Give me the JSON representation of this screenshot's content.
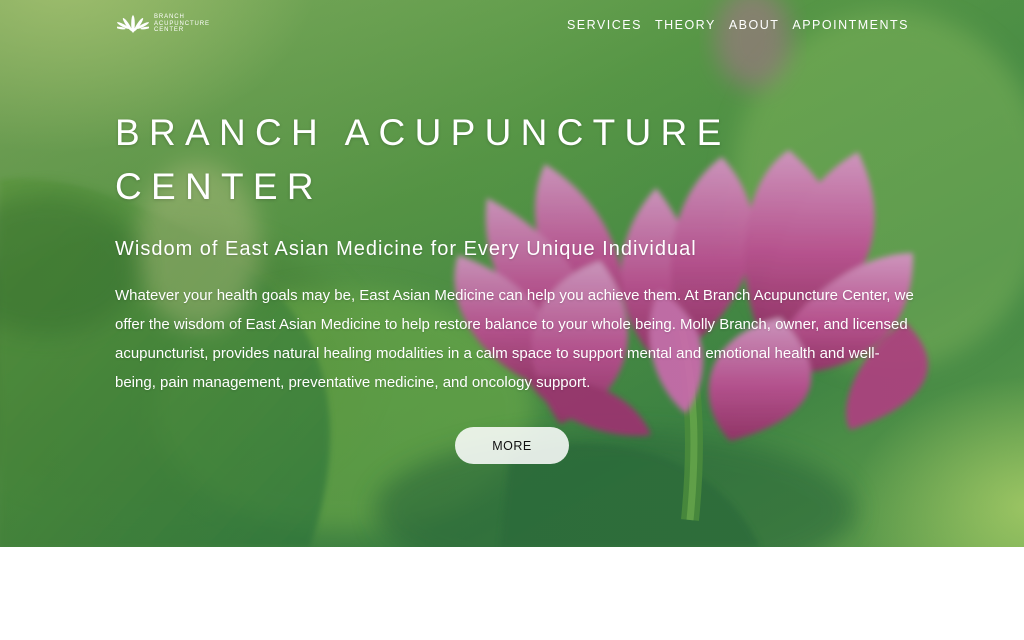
{
  "brand": {
    "logo_lines": [
      "BRANCH",
      "ACUPUNCTURE",
      "CENTER"
    ]
  },
  "nav": {
    "items": [
      {
        "label": "SERVICES"
      },
      {
        "label": "THEORY"
      },
      {
        "label": "ABOUT"
      },
      {
        "label": "APPOINTMENTS"
      }
    ]
  },
  "hero": {
    "title": "BRANCH ACUPUNCTURE CENTER",
    "subtitle": "Wisdom of East Asian Medicine for Every Unique Individual",
    "body": "Whatever your health goals may be, East Asian Medicine can help you achieve them. At Branch Acupuncture Center, we offer the wisdom of East Asian Medicine to help restore balance to your whole being. Molly Branch, owner, and licensed acupuncturist, provides natural healing modalities in a calm space to support mental and emotional health and well-being, pain management, preventative medicine, and oncology support.",
    "button_label": "MORE",
    "background_image": "pink lotus flower with green lily pad leaves"
  },
  "colors": {
    "text_on_hero": "#ffffff",
    "lotus_pink": "#c94f9c",
    "leaf_green": "#5f9f4a",
    "button_fill": "#f2f2f2",
    "page_background": "#ffffff"
  }
}
